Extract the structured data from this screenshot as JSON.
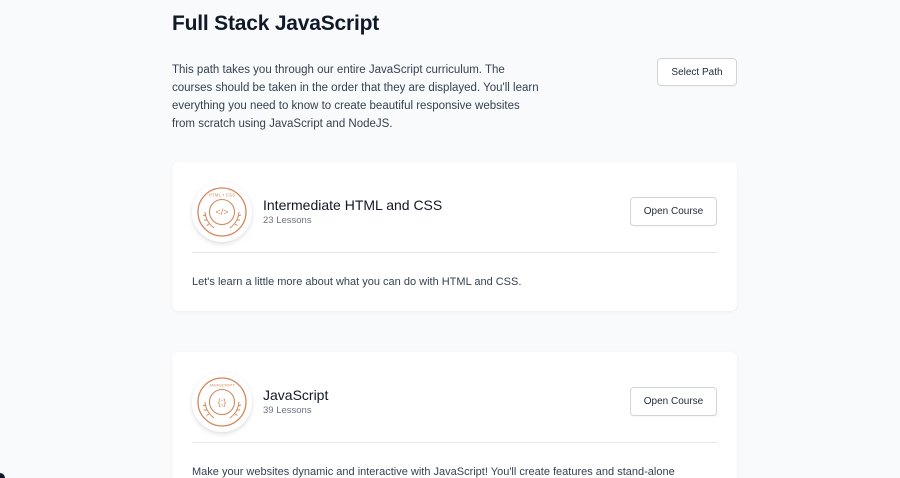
{
  "path": {
    "title": "Full Stack JavaScript",
    "description": "This path takes you through our entire JavaScript curriculum. The courses should be taken in the order that they are displayed. You'll learn everything you need to know to create beautiful responsive websites from scratch using JavaScript and NodeJS.",
    "select_button": "Select Path"
  },
  "courses": [
    {
      "title": "Intermediate HTML and CSS",
      "lessons": "23 Lessons",
      "button": "Open Course",
      "description": "Let's learn a little more about what you can do with HTML and CSS.",
      "badge_icon": "html-css-badge-icon",
      "badge_symbol": "</>",
      "badge_caption": "HTML • CSS"
    },
    {
      "title": "JavaScript",
      "lessons": "39 Lessons",
      "button": "Open Course",
      "description": "Make your websites dynamic and interactive with JavaScript! You'll create features and stand-alone",
      "badge_icon": "javascript-badge-icon",
      "badge_symbol": "{;}",
      "badge_caption": "JAVASCRIPT"
    }
  ],
  "colors": {
    "badge_accent": "#d4865a",
    "background": "#f9fafb",
    "card": "#ffffff"
  }
}
